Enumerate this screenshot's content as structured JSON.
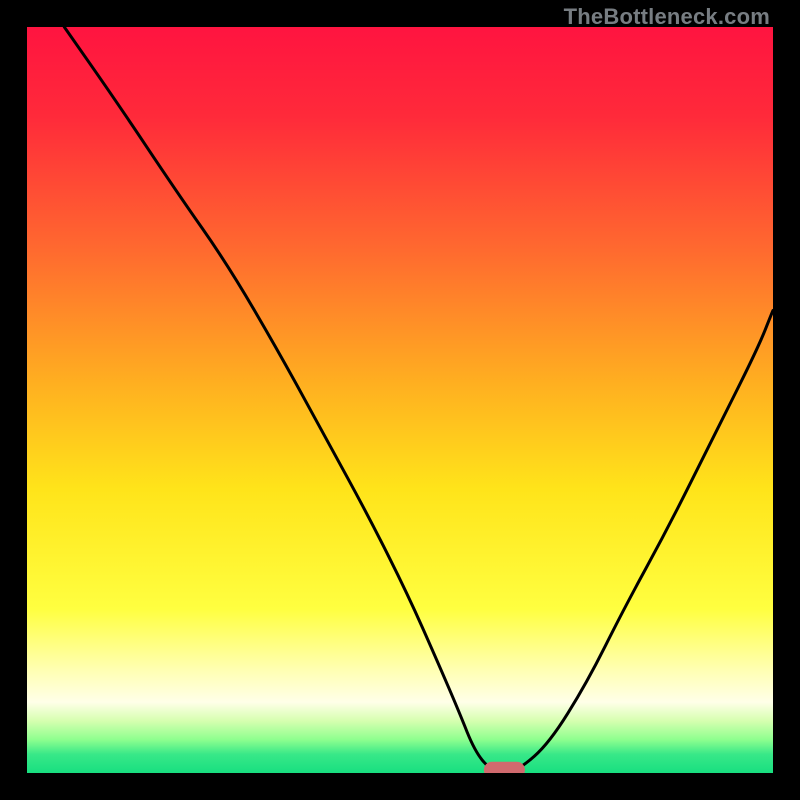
{
  "watermark": "TheBottleneck.com",
  "colors": {
    "frame": "#000000",
    "gradient_stops": [
      {
        "offset": 0.0,
        "color": "#ff1440"
      },
      {
        "offset": 0.12,
        "color": "#ff2a3a"
      },
      {
        "offset": 0.3,
        "color": "#ff6a2f"
      },
      {
        "offset": 0.48,
        "color": "#ffb020"
      },
      {
        "offset": 0.62,
        "color": "#ffe41a"
      },
      {
        "offset": 0.78,
        "color": "#ffff40"
      },
      {
        "offset": 0.86,
        "color": "#ffffb0"
      },
      {
        "offset": 0.905,
        "color": "#ffffe8"
      },
      {
        "offset": 0.93,
        "color": "#d6ffb0"
      },
      {
        "offset": 0.955,
        "color": "#8fff8f"
      },
      {
        "offset": 0.975,
        "color": "#38e888"
      },
      {
        "offset": 1.0,
        "color": "#18df80"
      }
    ],
    "curve": "#000000",
    "marker": "#d16a6e"
  },
  "chart_data": {
    "type": "line",
    "title": "",
    "xlabel": "",
    "ylabel": "",
    "xlim": [
      0,
      100
    ],
    "ylim": [
      0,
      100
    ],
    "series": [
      {
        "name": "bottleneck-curve",
        "x": [
          5,
          12,
          20,
          27,
          34,
          40,
          46,
          51,
          55,
          58,
          60,
          62,
          64,
          66,
          70,
          75,
          80,
          86,
          92,
          98,
          100
        ],
        "y": [
          100,
          90,
          78,
          68,
          56,
          45,
          34,
          24,
          15,
          8,
          3,
          0.5,
          0,
          0.5,
          4,
          12,
          22,
          33,
          45,
          57,
          62
        ]
      }
    ],
    "marker": {
      "x": 64,
      "y": 0,
      "width_x": 5.5,
      "height_y": 2.2
    }
  }
}
